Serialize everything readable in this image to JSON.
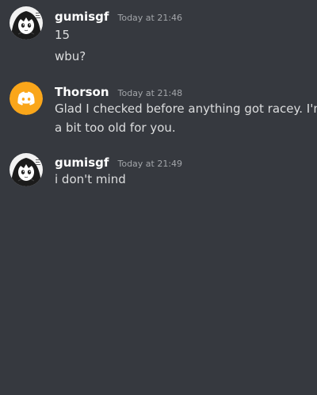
{
  "messages": [
    {
      "username": "gumisgf",
      "timestamp": "Today at 21:46",
      "lines": [
        "15",
        "wbu?"
      ],
      "avatar": "anime-girl-avatar"
    },
    {
      "username": "Thorson",
      "timestamp": "Today at 21:48",
      "lines": [
        "Glad I checked before anything got racey. I'm",
        "a bit too old for you."
      ],
      "avatar": "discord-logo-avatar",
      "avatar_color": "#faa61a"
    },
    {
      "username": "gumisgf",
      "timestamp": "Today at 21:49",
      "lines": [
        "i don't mind"
      ],
      "avatar": "anime-girl-avatar"
    }
  ],
  "colors": {
    "background": "#36393f",
    "username": "#ffffff",
    "timestamp": "#a3a6aa",
    "text": "#dcddde"
  }
}
